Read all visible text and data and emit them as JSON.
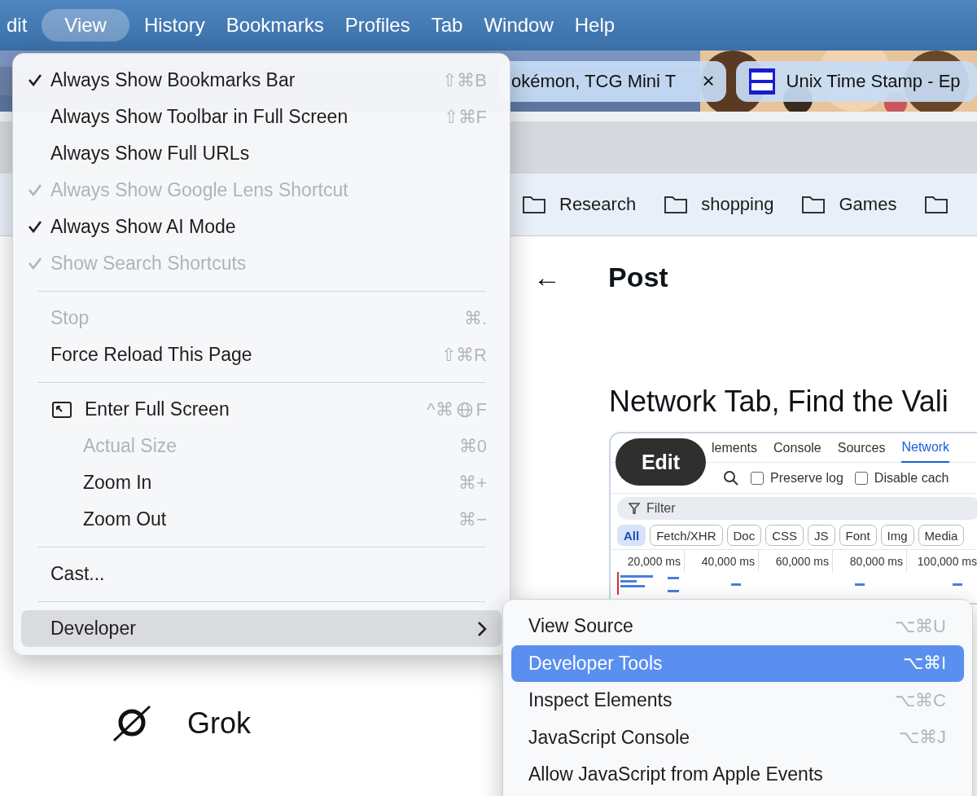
{
  "menu_bar": [
    {
      "label": "dit",
      "selected": false
    },
    {
      "label": "View",
      "selected": true
    },
    {
      "label": "History",
      "selected": false
    },
    {
      "label": "Bookmarks",
      "selected": false
    },
    {
      "label": "Profiles",
      "selected": false
    },
    {
      "label": "Tab",
      "selected": false
    },
    {
      "label": "Window",
      "selected": false
    },
    {
      "label": "Help",
      "selected": false
    }
  ],
  "tabs": [
    {
      "title": "okémon, TCG Mini T",
      "close": "×"
    },
    {
      "title": "Unix Time Stamp - Ep"
    }
  ],
  "bookmarks": [
    {
      "kind": "labeled",
      "label": "Research"
    },
    {
      "kind": "labeled",
      "label": "shopping"
    },
    {
      "kind": "labeled",
      "label": "Games"
    },
    {
      "kind": "icon_only"
    }
  ],
  "page": {
    "back": "←",
    "title": "Post",
    "article_title": "Network Tab, Find the Vali",
    "devtools": {
      "tabs": [
        {
          "label": "lements",
          "selected": false
        },
        {
          "label": "Console",
          "selected": false
        },
        {
          "label": "Sources",
          "selected": false
        },
        {
          "label": "Network",
          "selected": true
        }
      ],
      "edit_button": "Edit",
      "options": [
        {
          "label": "Preserve log",
          "checked": false
        },
        {
          "label": "Disable cach",
          "checked": false
        }
      ],
      "filter_placeholder": "Filter",
      "chips": [
        {
          "label": "All",
          "selected": true
        },
        {
          "label": "Fetch/XHR",
          "selected": false
        },
        {
          "label": "Doc",
          "selected": false
        },
        {
          "label": "CSS",
          "selected": false
        },
        {
          "label": "JS",
          "selected": false
        },
        {
          "label": "Font",
          "selected": false
        },
        {
          "label": "Img",
          "selected": false
        },
        {
          "label": "Media",
          "selected": false
        }
      ],
      "timeline": [
        "20,000 ms",
        "40,000 ms",
        "60,000 ms",
        "80,000 ms",
        "100,000 ms"
      ]
    },
    "sidebar_item": "Grok"
  },
  "view_menu": [
    {
      "kind": "item",
      "label": "Always Show Bookmarks Bar",
      "checked": true,
      "disabled": false,
      "shortcut": "⇧⌘B"
    },
    {
      "kind": "item",
      "label": "Always Show Toolbar in Full Screen",
      "checked": false,
      "disabled": false,
      "shortcut": "⇧⌘F"
    },
    {
      "kind": "item",
      "label": "Always Show Full URLs",
      "checked": false,
      "disabled": false
    },
    {
      "kind": "item",
      "label": "Always Show Google Lens Shortcut",
      "checked": true,
      "disabled": true
    },
    {
      "kind": "item",
      "label": "Always Show AI Mode",
      "checked": true,
      "disabled": false
    },
    {
      "kind": "item",
      "label": "Show Search Shortcuts",
      "checked": true,
      "disabled": true
    },
    {
      "kind": "separator"
    },
    {
      "kind": "item",
      "label": "Stop",
      "checked": false,
      "disabled": true,
      "shortcut": "⌘."
    },
    {
      "kind": "item",
      "label": "Force Reload This Page",
      "checked": false,
      "disabled": false,
      "shortcut": "⇧⌘R"
    },
    {
      "kind": "separator"
    },
    {
      "kind": "fullscreen",
      "label": "Enter Full Screen",
      "checked": false,
      "disabled": false,
      "shortcut": "^⌘",
      "globe_key": true,
      "shortcut_key": "F"
    },
    {
      "kind": "indented",
      "label": "Actual Size",
      "checked": false,
      "disabled": true,
      "shortcut": "⌘0"
    },
    {
      "kind": "indented",
      "label": "Zoom In",
      "checked": false,
      "disabled": false,
      "shortcut": "⌘+"
    },
    {
      "kind": "indented",
      "label": "Zoom Out",
      "checked": false,
      "disabled": false,
      "shortcut": "⌘−"
    },
    {
      "kind": "separator"
    },
    {
      "kind": "item",
      "label": "Cast...",
      "checked": false,
      "disabled": false
    },
    {
      "kind": "separator"
    },
    {
      "kind": "submenu",
      "label": "Developer",
      "checked": false,
      "disabled": false,
      "selected": true
    }
  ],
  "developer_menu": [
    {
      "label": "View Source",
      "shortcut": "⌥⌘U",
      "selected": false
    },
    {
      "label": "Developer Tools",
      "shortcut": "⌥⌘I",
      "selected": true
    },
    {
      "label": "Inspect Elements",
      "shortcut": "⌥⌘C",
      "selected": false
    },
    {
      "label": "JavaScript Console",
      "shortcut": "⌥⌘J",
      "selected": false
    },
    {
      "label": "Allow JavaScript from Apple Events",
      "selected": false
    }
  ]
}
